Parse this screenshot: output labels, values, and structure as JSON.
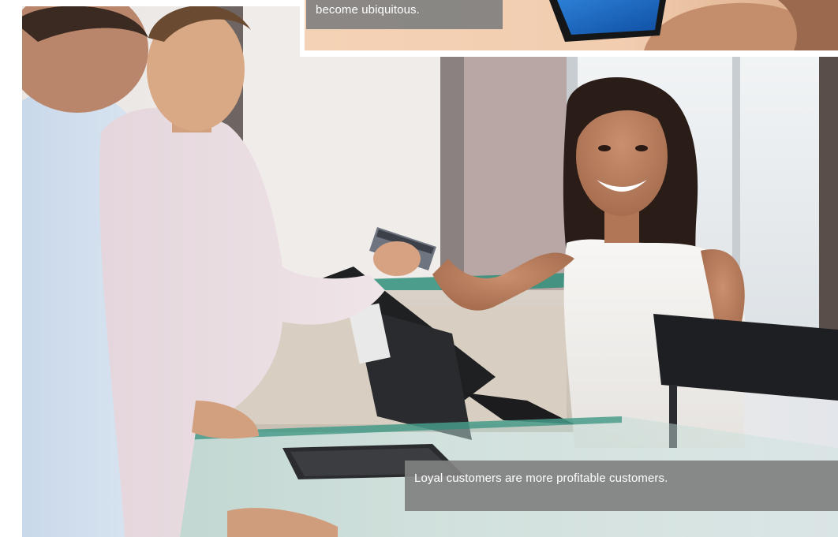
{
  "captions": {
    "top": "become ubiquitous.",
    "bottom": "Loyal customers are more profitable customers."
  },
  "photos": {
    "main_alt": "Cashier smiling while taking a credit card from a customer at a glass checkout counter",
    "inset_alt": "Hand holding a smartphone with a blue screen"
  },
  "colors": {
    "caption_bg": "#808080",
    "caption_text": "#ffffff",
    "counter_glass": "#2f8f7a"
  }
}
